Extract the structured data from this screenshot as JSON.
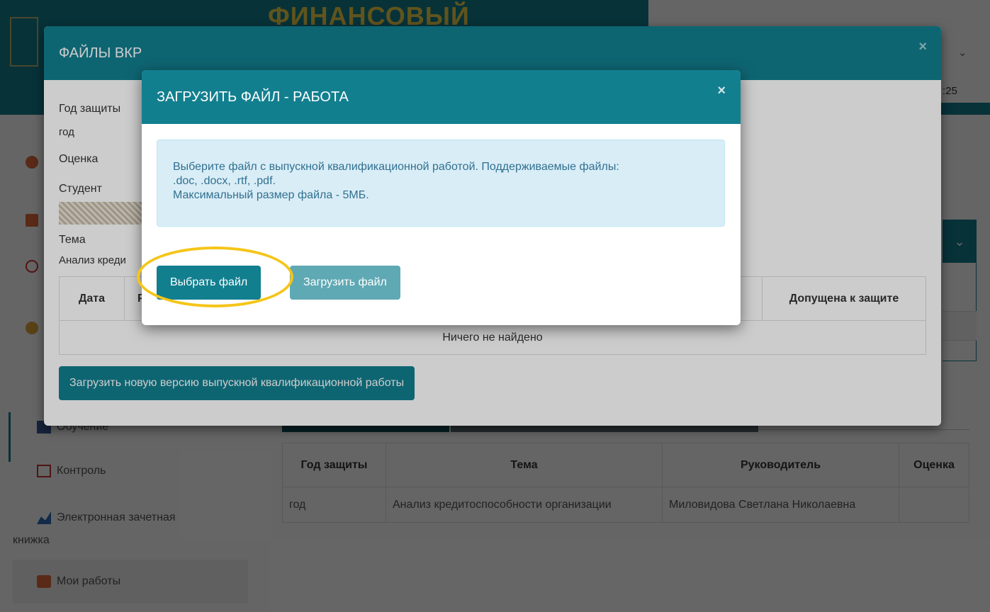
{
  "header": {
    "brand": "ФИНАНСОВЫЙ",
    "time": ":25"
  },
  "sidebar": {
    "items": [
      {
        "label": "Обучение"
      },
      {
        "label": "Контроль"
      },
      {
        "label": "Электронная зачетная",
        "label2": "книжка"
      },
      {
        "label": "Мои работы"
      }
    ]
  },
  "bg_table": {
    "headers": [
      "Год защиты",
      "Тема",
      "Руководитель",
      "Оценка"
    ],
    "row": [
      "год",
      "Анализ кредитоспособности организации",
      "Миловидова Светлана Николаевна",
      ""
    ]
  },
  "modal_files": {
    "title": "ФАЙЛЫ ВКР",
    "close": "×",
    "year_label": "Год защиты",
    "year_value": "год",
    "grade_label": "Оценка",
    "student_label": "Студент",
    "topic_label": "Тема",
    "topic_value": "Анализ креди",
    "table_headers": [
      "Дата",
      "Р",
      "Допущена к защите"
    ],
    "empty_text": "Ничего не найдено",
    "upload_new_button": "Загрузить новую версию выпускной квалификационной работы"
  },
  "modal_upload": {
    "title": "ЗАГРУЗИТЬ ФАЙЛ - РАБОТА",
    "close": "×",
    "info_line1": "Выберите файл с выпускной квалификационной работой. Поддерживаемые файлы:",
    "info_line2": ".doc, .docx, .rtf, .pdf.",
    "info_line3": "Максимальный размер файла - 5МБ.",
    "select_button": "Выбрать файл",
    "upload_button": "Загрузить файл"
  },
  "colors": {
    "primary": "#127f8f",
    "info_bg": "#d9edf7",
    "info_text": "#31708f",
    "highlight": "#f5c518"
  }
}
